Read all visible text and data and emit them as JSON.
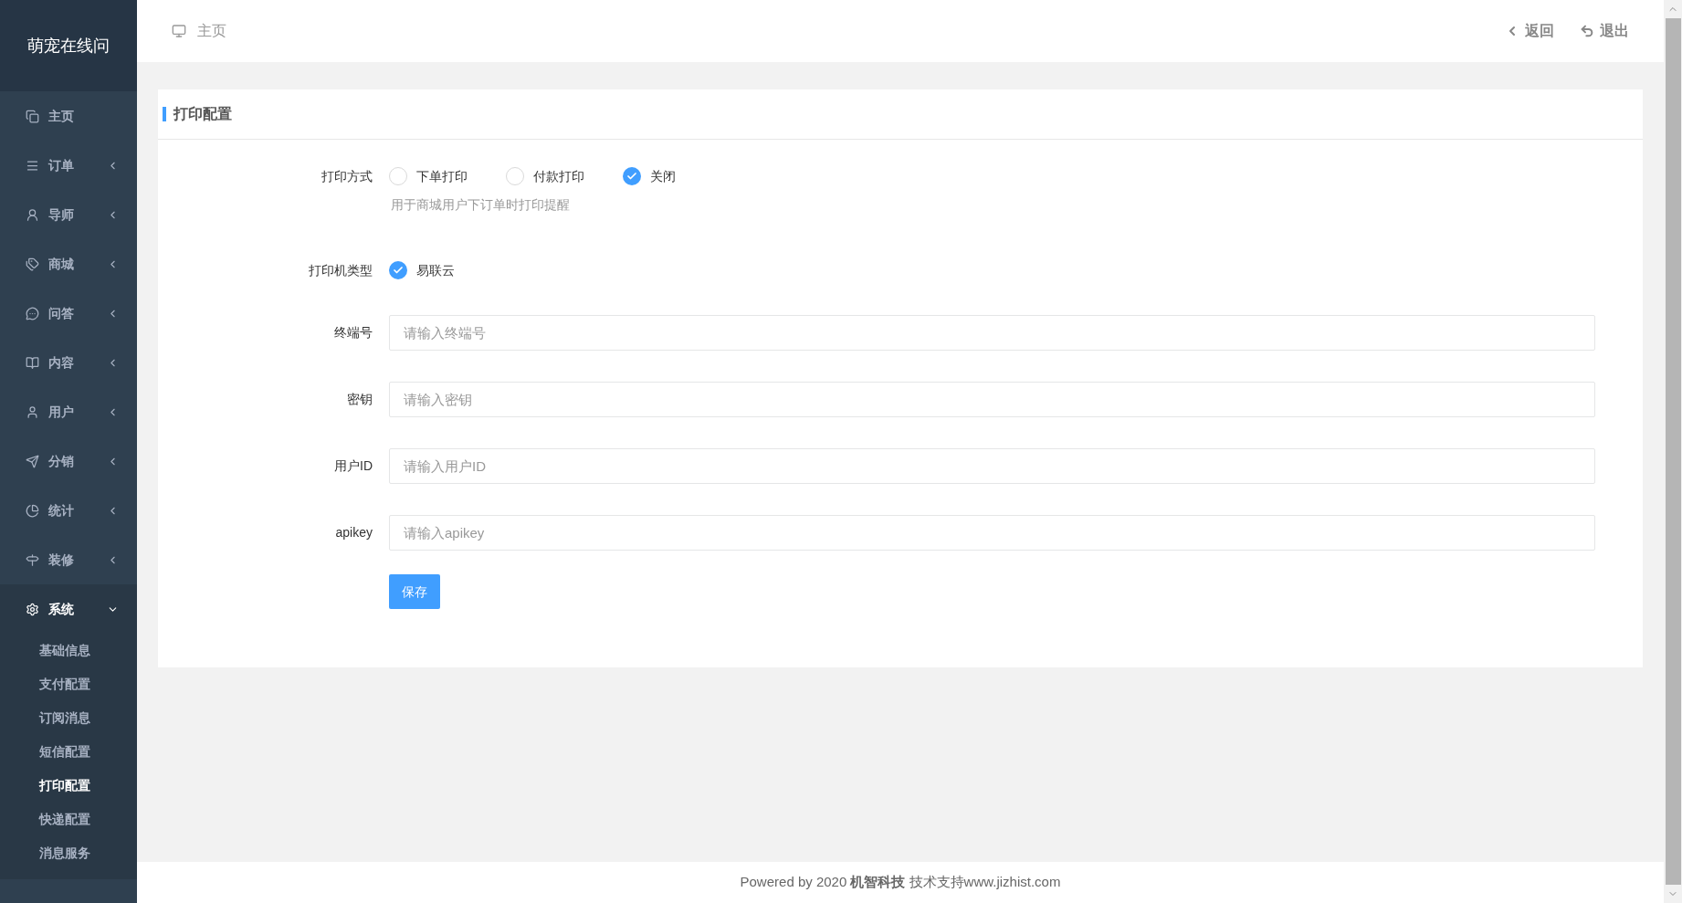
{
  "sidebar": {
    "logo": "萌宠在线问",
    "items": [
      {
        "kind": "link",
        "label": "主页",
        "expanded": false
      },
      {
        "kind": "group",
        "label": "订单",
        "expanded": false
      },
      {
        "kind": "group",
        "label": "导师",
        "expanded": false
      },
      {
        "kind": "group",
        "label": "商城",
        "expanded": false
      },
      {
        "kind": "group",
        "label": "问答",
        "expanded": false
      },
      {
        "kind": "group",
        "label": "内容",
        "expanded": false
      },
      {
        "kind": "group",
        "label": "用户",
        "expanded": false
      },
      {
        "kind": "group",
        "label": "分销",
        "expanded": false
      },
      {
        "kind": "group",
        "label": "统计",
        "expanded": false
      },
      {
        "kind": "group",
        "label": "装修",
        "expanded": false
      },
      {
        "kind": "group",
        "label": "系统",
        "expanded": true,
        "children": [
          {
            "label": "基础信息",
            "selected": false
          },
          {
            "label": "支付配置",
            "selected": false
          },
          {
            "label": "订阅消息",
            "selected": false
          },
          {
            "label": "短信配置",
            "selected": false
          },
          {
            "label": "打印配置",
            "selected": true
          },
          {
            "label": "快递配置",
            "selected": false
          },
          {
            "label": "消息服务",
            "selected": false
          }
        ]
      }
    ]
  },
  "header": {
    "breadcrumb": "主页",
    "actions": [
      {
        "label": "返回"
      },
      {
        "label": "退出"
      }
    ]
  },
  "card": {
    "title": "打印配置",
    "fields": [
      {
        "kind": "radio",
        "label": "打印方式",
        "options": [
          {
            "label": "下单打印",
            "selected": false
          },
          {
            "label": "付款打印",
            "selected": false
          },
          {
            "label": "关闭",
            "selected": true
          }
        ],
        "help": "用于商城用户下订单时打印提醒"
      },
      {
        "kind": "radio",
        "label": "打印机类型",
        "options": [
          {
            "label": "易联云",
            "selected": true
          }
        ]
      },
      {
        "kind": "input",
        "label": "终端号",
        "placeholder": "请输入终端号"
      },
      {
        "kind": "input",
        "label": "密钥",
        "placeholder": "请输入密钥"
      },
      {
        "kind": "input",
        "label": "用户ID",
        "placeholder": "请输入用户ID"
      },
      {
        "kind": "input",
        "label": "apikey",
        "placeholder": "请输入apikey"
      }
    ],
    "submit": "保存"
  },
  "footer": {
    "prefix": "Powered by 2020 ",
    "company": "机智科技",
    "suffix": " 技术支持www.jizhist.com"
  }
}
